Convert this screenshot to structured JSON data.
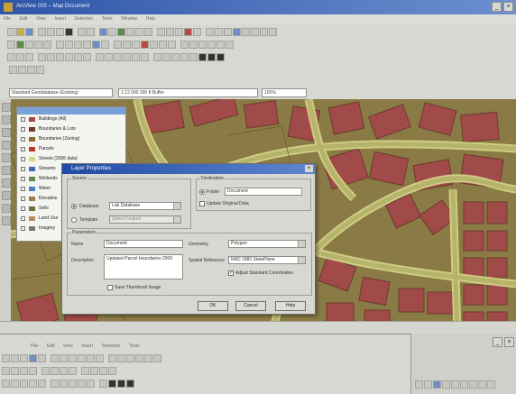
{
  "window": {
    "title": "ArcView GIS – Map Document",
    "minimize": "_",
    "close": "×"
  },
  "menu": [
    "File",
    "Edit",
    "View",
    "Insert",
    "Selection",
    "Tools",
    "Window",
    "Help"
  ],
  "selector": {
    "left": "Standard Geodatabase (Existing)",
    "mid": "1:12,000   200 ft Buffer",
    "right": "100%"
  },
  "toc": {
    "layers": [
      {
        "label": "Buildings (All)",
        "color": "#a14a3e"
      },
      {
        "label": "Boundaries & Lots",
        "color": "#6a3c2b"
      },
      {
        "label": "Boundaries (Zoning)",
        "color": "#8a6a2b"
      },
      {
        "label": "Parcels",
        "color": "#c2332a"
      },
      {
        "label": "Streets (2006 data)",
        "color": "#d8d28a"
      },
      {
        "label": "Streams",
        "color": "#3f67b5"
      },
      {
        "label": "Wetlands",
        "color": "#5d8a4a"
      },
      {
        "label": "Water",
        "color": "#4a7fc0"
      },
      {
        "label": "Elevation",
        "color": "#9c7a4f"
      },
      {
        "label": "Soils",
        "color": "#7a6a3f"
      },
      {
        "label": "Land Use",
        "color": "#b38b5e"
      },
      {
        "label": "Imagery",
        "color": "#777777"
      }
    ]
  },
  "dialog": {
    "title": "Layer Properties",
    "close": "×",
    "source_group": "Source",
    "opt_database": "Database",
    "opt_database_value": "Lab Database",
    "opt_template": "Template",
    "opt_template_value": "Select Feature",
    "dest_group": "Destination",
    "opt_folder": "Folder",
    "opt_folder_value": "Document",
    "opt_update": "Update Original Data",
    "params_group": "Parameters",
    "name_label": "Name",
    "name_value": "Document",
    "desc_label": "Description",
    "desc_value": "Updated Parcel boundaries 2006",
    "chk_save": "Save Thumbnail Image",
    "geometry_label": "Geometry",
    "geometry_value": "Polygon",
    "spatial_label": "Spatial Reference",
    "spatial_value": "NAD 1983 StatePlane",
    "chk_adjust": "Adjust Standard Coordinates",
    "ok": "OK",
    "cancel": "Cancel",
    "help": "Help"
  },
  "colors": {
    "parcel_fill": "#a14a4a",
    "land_fill": "#8a7a45",
    "road_fill": "#b6b46a",
    "road_edge": "#d7d68a",
    "title_blue": "#1f4aa3"
  }
}
